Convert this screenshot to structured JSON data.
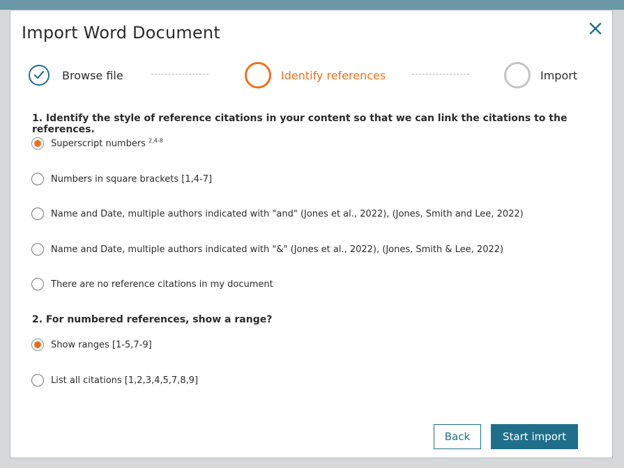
{
  "dialog": {
    "title": "Import Word Document"
  },
  "stepper": {
    "steps": [
      {
        "label": "Browse file",
        "state": "complete"
      },
      {
        "label": "Identify references",
        "state": "active"
      },
      {
        "label": "Import",
        "state": "pending"
      }
    ]
  },
  "questions": [
    {
      "text": "1. Identify the style of reference citations in your content so that we can link the citations to the references.",
      "options": [
        {
          "label": "Superscript numbers",
          "sup": "2,4-8",
          "selected": true
        },
        {
          "label": "Numbers in square brackets [1,4-7]",
          "selected": false
        },
        {
          "label": "Name and Date, multiple authors indicated with \"and\" (Jones et al., 2022), (Jones, Smith and Lee, 2022)",
          "selected": false
        },
        {
          "label": "Name and Date, multiple authors indicated with \"&\" (Jones et al., 2022), (Jones, Smith & Lee, 2022)",
          "selected": false
        },
        {
          "label": "There are no reference citations in my document",
          "selected": false
        }
      ]
    },
    {
      "text": "2. For numbered references, show a range?",
      "options": [
        {
          "label": "Show ranges [1-5,7-9]",
          "selected": true
        },
        {
          "label": "List all citations [1,2,3,4,5,7,8,9]",
          "selected": false
        }
      ]
    }
  ],
  "actions": {
    "back_label": "Back",
    "start_label": "Start import"
  },
  "colors": {
    "primary": "#1f6f8b",
    "accent": "#e9711c",
    "pending": "#c1c3c5"
  }
}
